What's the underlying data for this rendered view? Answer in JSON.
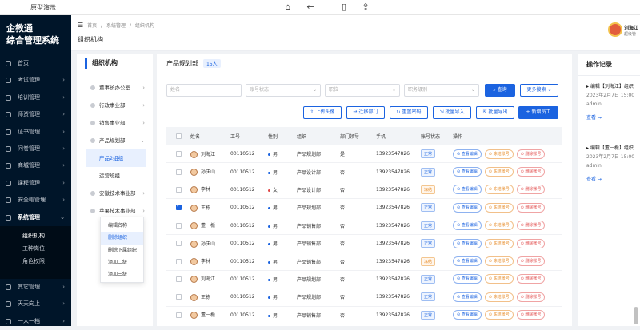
{
  "browser": {
    "title": "原型演示",
    "icons": [
      "home-icon",
      "back-icon",
      "sitemap-icon",
      "share-icon"
    ]
  },
  "app": {
    "brand_line1": "企教通",
    "brand_line2": "综合管理系统"
  },
  "sidebar": {
    "items": [
      {
        "label": "首页",
        "icon": "home-icon",
        "chev": ""
      },
      {
        "label": "考试管理",
        "icon": "exam-icon",
        "chev": "›"
      },
      {
        "label": "培训管理",
        "icon": "training-icon",
        "chev": "›"
      },
      {
        "label": "师资管理",
        "icon": "teacher-icon",
        "chev": "›"
      },
      {
        "label": "证书管理",
        "icon": "certificate-icon",
        "chev": "›"
      },
      {
        "label": "问卷管理",
        "icon": "survey-icon",
        "chev": "›"
      },
      {
        "label": "商城管理",
        "icon": "shop-icon",
        "chev": "›"
      },
      {
        "label": "课程管理",
        "icon": "course-icon",
        "chev": "›"
      },
      {
        "label": "安全帽管理",
        "icon": "helmet-icon",
        "chev": "›"
      },
      {
        "label": "系统管理",
        "icon": "gear-icon",
        "chev": "⌄"
      }
    ],
    "sub_items": [
      "组织机构",
      "工种岗位",
      "角色权限"
    ],
    "items_after": [
      {
        "label": "其它管理",
        "icon": "other-icon",
        "chev": "›"
      },
      {
        "label": "天天向上",
        "icon": "daily-icon",
        "chev": "›"
      },
      {
        "label": "一人一档",
        "icon": "file-icon",
        "chev": "›"
      }
    ]
  },
  "topbar": {
    "breadcrumbs": [
      "首页",
      "/",
      "系统管理",
      "/",
      "组织机构"
    ],
    "page_title": "组织机构",
    "user_name": "刘海江",
    "user_role": "超级管"
  },
  "org": {
    "title": "组织机构",
    "tree": [
      {
        "label": "董事长办公室",
        "arrow": "›"
      },
      {
        "label": "行政事业部",
        "arrow": "›"
      },
      {
        "label": "销售事业部",
        "arrow": "›"
      },
      {
        "label": "产品规划部",
        "arrow": "⌄"
      }
    ],
    "children": [
      "产品2组组",
      "运营班组"
    ],
    "tree_after": [
      {
        "label": "安徽技术事业部",
        "arrow": "›"
      },
      {
        "label": "苹果技术事业部",
        "arrow": "›"
      }
    ],
    "context_menu": [
      "编辑名称",
      "删除组织",
      "删除下属组织",
      "添加二级",
      "添加三级"
    ]
  },
  "main": {
    "title": "产品规划部",
    "count": "15人",
    "filters": {
      "name_placeholder": "姓名",
      "status_placeholder": "账号状态",
      "post_placeholder": "职位",
      "role_placeholder": "职务级别",
      "search": "查询",
      "more": "更多搜索"
    },
    "toolbar": [
      "上传头像",
      "迁移部门",
      "重置密码",
      "批量导入",
      "批量导出",
      "新增员工"
    ],
    "columns": [
      "",
      "姓名",
      "工号",
      "性别",
      "组织",
      "部门领导",
      "手机",
      "账号状态",
      "操作"
    ],
    "rows": [
      {
        "name": "刘海江",
        "id": "00110512",
        "sex": "男",
        "sex_color": "#1b63e0",
        "org": "产品规划部",
        "leader": "是",
        "phone": "13923547826",
        "status": "正常",
        "status_type": "ok",
        "checked": false
      },
      {
        "name": "孙庆山",
        "id": "00110512",
        "sex": "男",
        "sex_color": "#1b63e0",
        "org": "产品设计部",
        "leader": "否",
        "phone": "13923547826",
        "status": "正常",
        "status_type": "ok",
        "checked": false
      },
      {
        "name": "李林",
        "id": "00110512",
        "sex": "女",
        "sex_color": "#e04848",
        "org": "产品设计部",
        "leader": "否",
        "phone": "13923547826",
        "status": "冻结",
        "status_type": "off",
        "checked": false
      },
      {
        "name": "王栋",
        "id": "00110512",
        "sex": "男",
        "sex_color": "#1b63e0",
        "org": "产品规划部",
        "leader": "否",
        "phone": "13923547826",
        "status": "正常",
        "status_type": "ok",
        "checked": true
      },
      {
        "name": "董一栀",
        "id": "00110512",
        "sex": "男",
        "sex_color": "#1b63e0",
        "org": "产品销售部",
        "leader": "否",
        "phone": "13923547826",
        "status": "正常",
        "status_type": "ok",
        "checked": false
      },
      {
        "name": "孙庆山",
        "id": "00110512",
        "sex": "男",
        "sex_color": "#1b63e0",
        "org": "产品销售部",
        "leader": "否",
        "phone": "13923547826",
        "status": "正常",
        "status_type": "ok",
        "checked": false
      },
      {
        "name": "李林",
        "id": "00110512",
        "sex": "男",
        "sex_color": "#1b63e0",
        "org": "产品销售部",
        "leader": "否",
        "phone": "13923547826",
        "status": "冻结",
        "status_type": "off",
        "checked": false
      },
      {
        "name": "刘海江",
        "id": "00110512",
        "sex": "男",
        "sex_color": "#1b63e0",
        "org": "产品规划部",
        "leader": "否",
        "phone": "13923547826",
        "status": "正常",
        "status_type": "ok",
        "checked": false
      },
      {
        "name": "王栋",
        "id": "00110512",
        "sex": "男",
        "sex_color": "#1b63e0",
        "org": "产品规划部",
        "leader": "否",
        "phone": "13923547826",
        "status": "正常",
        "status_type": "ok",
        "checked": false
      },
      {
        "name": "董一栀",
        "id": "00110512",
        "sex": "男",
        "sex_color": "#1b63e0",
        "org": "产品销售部",
        "leader": "否",
        "phone": "13923547826",
        "status": "正常",
        "status_type": "ok",
        "checked": false
      }
    ],
    "row_actions": [
      "查看编辑",
      "冻结账号",
      "删除账号"
    ]
  },
  "log": {
    "title": "操作记录",
    "entries": [
      {
        "title": "编辑【刘海江】组织",
        "date": "2023年2月7日 15:00",
        "user": "admin",
        "more": "查看 →"
      },
      {
        "title": "编辑【董一栀】组织",
        "date": "2023年2月7日 15:00",
        "user": "admin",
        "more": "查看 →"
      }
    ]
  },
  "colors": {
    "primary": "#1b63e0",
    "sidebar_bg": "#001529",
    "warning": "#e6861e",
    "danger": "#e04848"
  }
}
